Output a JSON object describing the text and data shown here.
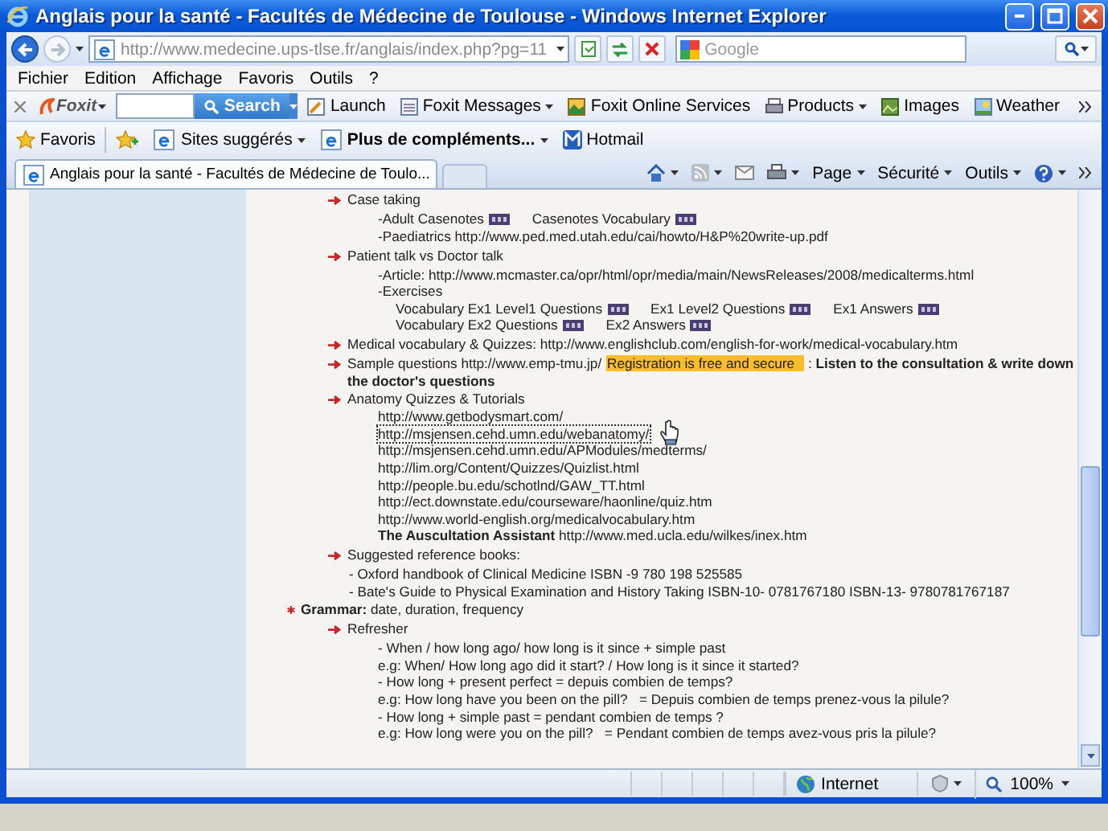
{
  "window": {
    "title": "Anglais pour la santé - Facultés de Médecine de Toulouse - Windows Internet Explorer"
  },
  "address_bar": {
    "url": "http://www.medecine.ups-tlse.fr/anglais/index.php?pg=11"
  },
  "search_box": {
    "placeholder": "Google"
  },
  "menu": [
    "Fichier",
    "Edition",
    "Affichage",
    "Favoris",
    "Outils",
    "?"
  ],
  "foxit_toolbar": {
    "logo": "Foxit",
    "search_button": "Search",
    "items": [
      {
        "label": "Launch",
        "dropdown": false
      },
      {
        "label": "Foxit Messages",
        "dropdown": true
      },
      {
        "label": "Foxit Online Services",
        "dropdown": false
      },
      {
        "label": "Products",
        "dropdown": true
      },
      {
        "label": "Images",
        "dropdown": false
      },
      {
        "label": "Weather",
        "dropdown": false
      }
    ]
  },
  "favorites_bar": {
    "favorites": "Favoris",
    "items": [
      {
        "label": "Sites suggérés",
        "emphasized": false,
        "dropdown": true
      },
      {
        "label": "Plus de compléments...",
        "emphasized": true,
        "dropdown": true
      },
      {
        "label": "Hotmail",
        "emphasized": false,
        "dropdown": false
      }
    ]
  },
  "tabs": [
    {
      "label": "Anglais pour la santé - Facultés de Médecine de Toulo...",
      "selected": true
    }
  ],
  "command_bar": [
    "Page",
    "Sécurité",
    "Outils"
  ],
  "content": [
    {
      "kind": "arrow-item",
      "parts": [
        {
          "text": "Case taking"
        }
      ]
    },
    {
      "kind": "sub-line",
      "parts": [
        {
          "text": "-Adult Casenotes",
          "pdf": true
        },
        {
          "text": "Casenotes Vocabulary",
          "pdf": true
        }
      ]
    },
    {
      "kind": "sub-line",
      "parts": [
        {
          "text": "-Paediatrics http://www.ped.med.utah.edu/cai/howto/H&P%20write-up.pdf"
        }
      ]
    },
    {
      "kind": "arrow-item",
      "parts": [
        {
          "text": "Patient talk vs Doctor talk"
        }
      ]
    },
    {
      "kind": "sub-line",
      "parts": [
        {
          "text": "-Article: http://www.mcmaster.ca/opr/html/opr/media/main/NewsReleases/2008/medicalterms.html"
        }
      ]
    },
    {
      "kind": "sub-line",
      "parts": [
        {
          "text": "-Exercises"
        }
      ]
    },
    {
      "kind": "exercise-line",
      "parts": [
        {
          "text": "Vocabulary Ex1 Level1 Questions",
          "pdf": true
        },
        {
          "text": "Ex1 Level2 Questions",
          "pdf": true
        },
        {
          "text": "Ex1 Answers",
          "pdf": true
        }
      ]
    },
    {
      "kind": "exercise-line",
      "parts": [
        {
          "text": "Vocabulary Ex2 Questions",
          "pdf": true
        },
        {
          "text": "Ex2 Answers",
          "pdf": true
        }
      ]
    },
    {
      "kind": "arrow-item",
      "parts": [
        {
          "text": "Medical vocabulary & Quizzes: http://www.englishclub.com/english-for-work/medical-vocabulary.htm"
        }
      ]
    },
    {
      "kind": "arrow-item",
      "parts": [
        {
          "text": "Sample questions http://www.emp-tmu.jp/"
        },
        {
          "text": "Registration is free and secure",
          "highlighted": true
        },
        {
          "text": ": **Listen to the consultation & write down the doctor's questions**"
        }
      ]
    },
    {
      "kind": "arrow-item",
      "parts": [
        {
          "text": "Anatomy Quizzes & Tutorials"
        }
      ]
    },
    {
      "kind": "link-line",
      "parts": [
        {
          "text": "http://www.getbodysmart.com/"
        }
      ]
    },
    {
      "kind": "link-line",
      "focused": true,
      "parts": [
        {
          "text": "http://msjensen.cehd.umn.edu/webanatomy/"
        }
      ]
    },
    {
      "kind": "link-line",
      "parts": [
        {
          "text": "http://msjensen.cehd.umn.edu/APModules/medterms/"
        }
      ]
    },
    {
      "kind": "link-line",
      "parts": [
        {
          "text": "http://lim.org/Content/Quizzes/Quizlist.html"
        }
      ]
    },
    {
      "kind": "link-line",
      "parts": [
        {
          "text": "http://people.bu.edu/schotlnd/GAW_TT.html"
        }
      ]
    },
    {
      "kind": "link-line",
      "parts": [
        {
          "text": "http://ect.downstate.edu/courseware/haonline/quiz.htm"
        }
      ]
    },
    {
      "kind": "link-line",
      "parts": [
        {
          "text": "http://www.world-english.org/medicalvocabulary.htm"
        }
      ]
    },
    {
      "kind": "link-line",
      "parts": [
        {
          "text": "**The Auscultation Assistant** http://www.med.ucla.edu/wilkes/inex.htm"
        }
      ]
    },
    {
      "kind": "arrow-item",
      "parts": [
        {
          "text": "Suggested reference books:"
        }
      ]
    },
    {
      "kind": "book-line",
      "parts": [
        {
          "text": "- Oxford handbook of Clinical Medicine ISBN -9 780 198 525585"
        }
      ]
    },
    {
      "kind": "book-line",
      "parts": [
        {
          "text": "- Bate's Guide to Physical Examination and History Taking ISBN-10- 0781767180 ISBN-13- 9780781767187"
        }
      ]
    },
    {
      "kind": "bullet-item",
      "parts": [
        {
          "text": "**Grammar:** date, duration, frequency"
        }
      ]
    },
    {
      "kind": "arrow-item",
      "parts": [
        {
          "text": "Refresher"
        }
      ]
    },
    {
      "kind": "sub-line",
      "parts": [
        {
          "text": "- When / how long ago/ how long is it since + simple past"
        }
      ]
    },
    {
      "kind": "sub-line",
      "parts": [
        {
          "text": "e.g: When/ How long ago did it start? / How long is it since it started?"
        }
      ]
    },
    {
      "kind": "sub-line",
      "parts": [
        {
          "text": "- How long + present perfect = depuis combien de temps?"
        }
      ]
    },
    {
      "kind": "sub-line",
      "parts": [
        {
          "text": "e.g: How long have you been on the pill?   = Depuis combien de temps prenez-vous la pilule?"
        }
      ]
    },
    {
      "kind": "sub-line",
      "parts": [
        {
          "text": "- How long + simple past = pendant combien de temps ?"
        }
      ]
    },
    {
      "kind": "sub-line",
      "parts": [
        {
          "text": "e.g: How long were you on the pill?   = Pendant combien de temps avez-vous pris la pilule?"
        }
      ]
    }
  ],
  "status_bar": {
    "zone": "Internet",
    "zoom": "100%"
  }
}
